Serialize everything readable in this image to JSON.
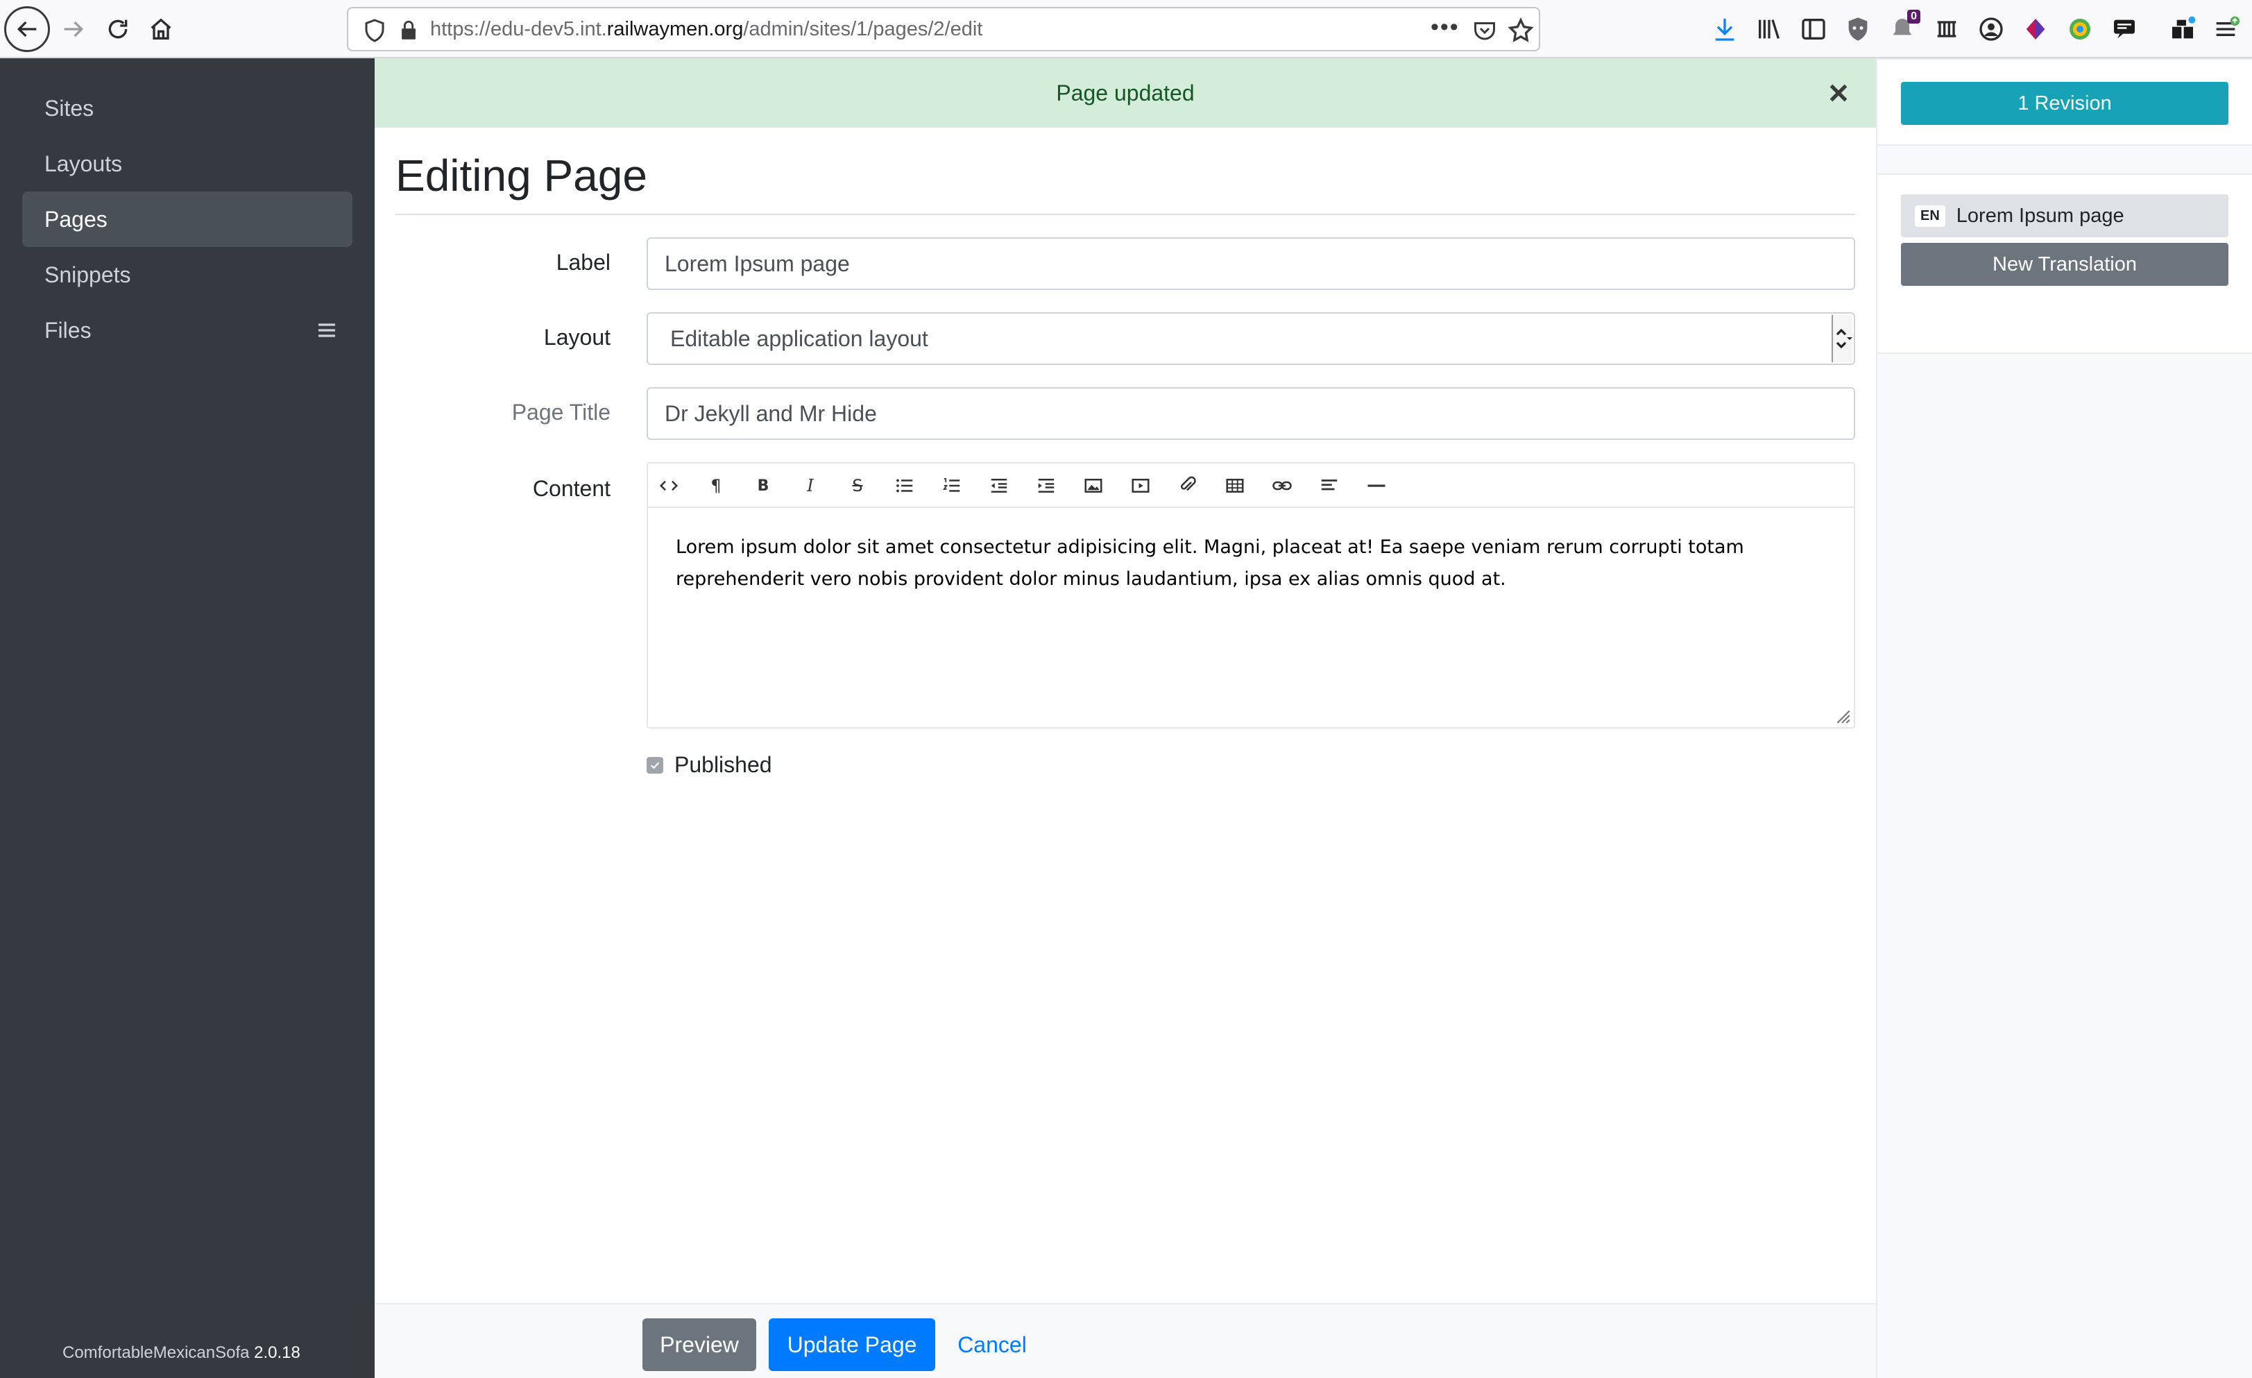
{
  "browser": {
    "url_prefix": "https://edu-dev5.int.",
    "url_domain": "railwaymen.org",
    "url_path": "/admin/sites/1/pages/2/edit",
    "overflow_menu": "•••",
    "notification_badge": "0"
  },
  "sidebar": {
    "items": [
      {
        "label": "Sites"
      },
      {
        "label": "Layouts"
      },
      {
        "label": "Pages"
      },
      {
        "label": "Snippets"
      },
      {
        "label": "Files"
      }
    ],
    "brand_name": "ComfortableMexicanSofa",
    "brand_version": "2.0.18"
  },
  "alert": {
    "message": "Page updated"
  },
  "page": {
    "title": "Editing Page"
  },
  "form": {
    "label_label": "Label",
    "label_value": "Lorem Ipsum page",
    "layout_label": "Layout",
    "layout_value": "Editable application layout",
    "page_title_label": "Page Title",
    "page_title_value": "Dr Jekyll and Mr Hide",
    "content_label": "Content",
    "content_text": "Lorem ipsum dolor sit amet consectetur adipisicing elit. Magni, placeat at! Ea saepe veniam rerum corrupti totam reprehenderit vero nobis provident dolor minus laudantium, ipsa ex alias omnis quod at.",
    "published_label": "Published",
    "published_checked": true
  },
  "editor_toolbar": {
    "tools": [
      "code-view",
      "paragraph",
      "bold",
      "italic",
      "strikethrough",
      "unordered-list",
      "ordered-list",
      "outdent",
      "indent",
      "image",
      "video",
      "file",
      "table",
      "link",
      "align",
      "horizontal-rule"
    ]
  },
  "actions": {
    "preview": "Preview",
    "update": "Update Page",
    "cancel": "Cancel"
  },
  "right_panel": {
    "revisions_label": "1 Revision",
    "translation_locale": "EN",
    "translation_label": "Lorem Ipsum page",
    "new_translation": "New Translation"
  },
  "colors": {
    "sidebar_bg": "#343a40",
    "alert_bg": "#d4edda",
    "alert_text": "#155724",
    "primary": "#007bff",
    "secondary": "#6c757d",
    "info": "#17a2b8"
  }
}
